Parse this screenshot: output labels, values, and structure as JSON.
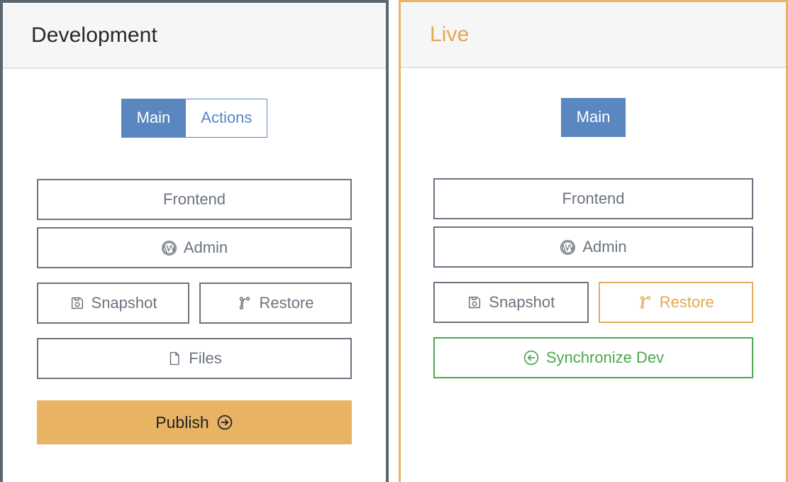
{
  "panels": [
    {
      "key": "development",
      "title": "Development",
      "accent": "#5c6670",
      "tabs": [
        {
          "label": "Main",
          "active": true
        },
        {
          "label": "Actions",
          "active": false
        }
      ],
      "buttons": {
        "frontend": "Frontend",
        "admin": "Admin",
        "snapshot": "Snapshot",
        "restore": "Restore",
        "files": "Files",
        "publish": "Publish"
      }
    },
    {
      "key": "live",
      "title": "Live",
      "accent": "#e8b463",
      "tabs": [
        {
          "label": "Main",
          "active": true
        }
      ],
      "buttons": {
        "frontend": "Frontend",
        "admin": "Admin",
        "snapshot": "Snapshot",
        "restore": "Restore",
        "synchronize": "Synchronize Dev"
      }
    }
  ],
  "icons": {
    "admin": "wordpress-icon",
    "snapshot": "floppy-save-icon",
    "restore": "git-branch-icon",
    "files": "document-icon",
    "publish": "arrow-right-circle-icon",
    "synchronize": "arrow-left-circle-icon"
  },
  "colors": {
    "tab_blue": "#5a87c0",
    "amber": "#e8b463",
    "green": "#4da74f",
    "slate": "#6b7480",
    "header_bg": "#f6f6f6"
  }
}
